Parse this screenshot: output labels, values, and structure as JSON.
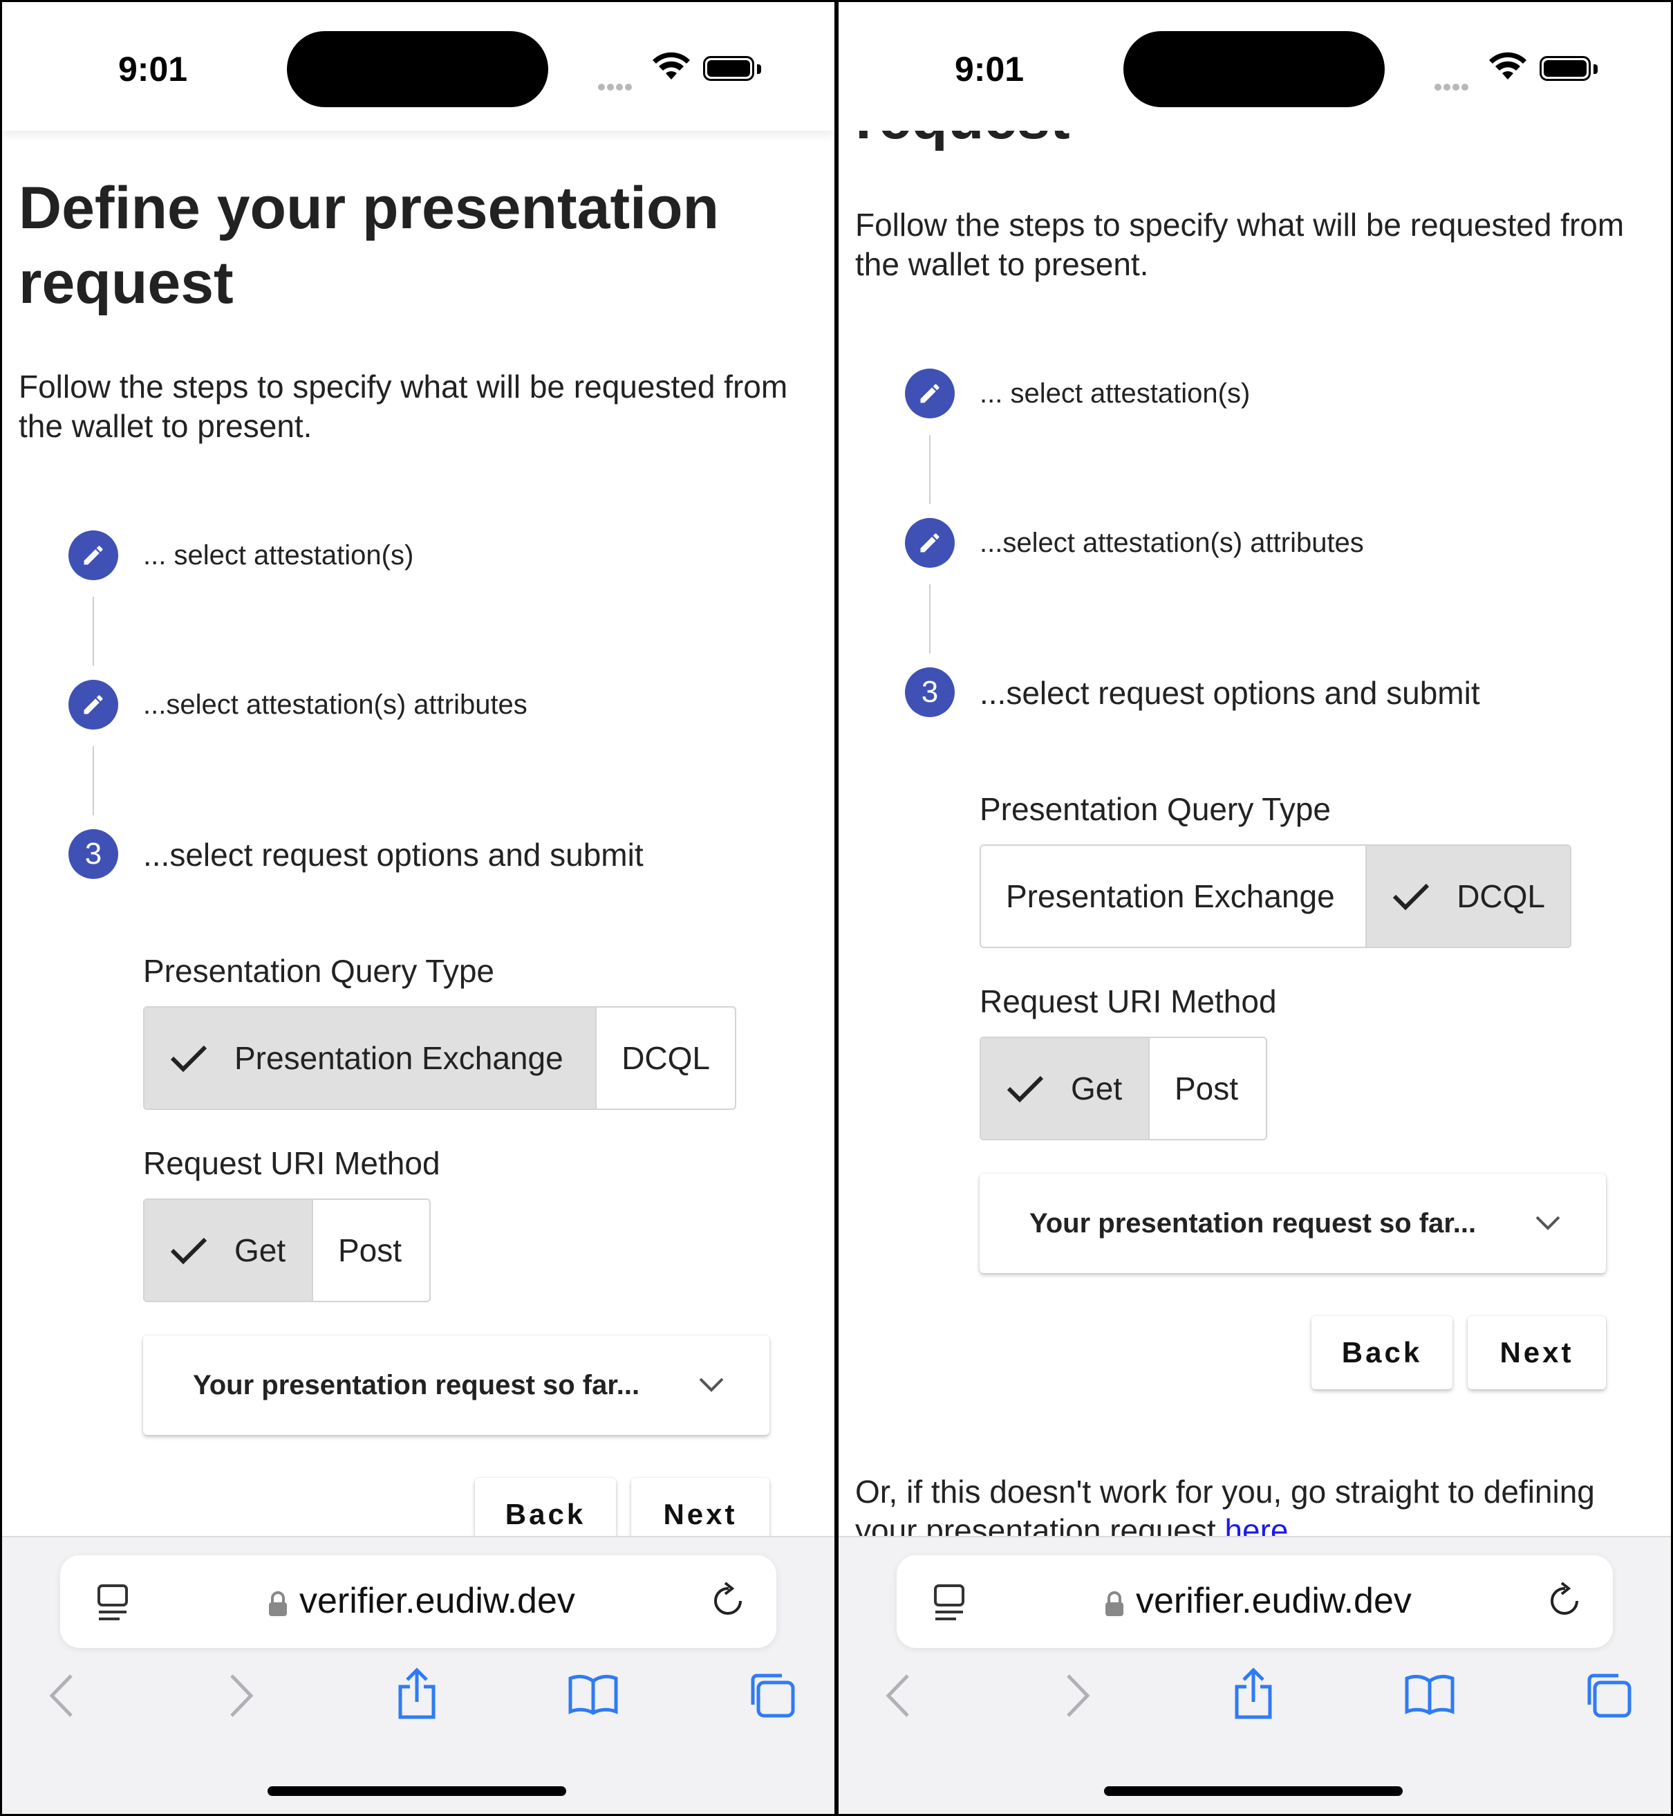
{
  "status_bar": {
    "time": "9:01"
  },
  "page": {
    "title": "Define your presentation request",
    "title_partial": "request",
    "intro": "Follow the steps to specify what will be requested from the wallet to present.",
    "steps": [
      {
        "label": "... select attestation(s)",
        "state": "edit",
        "icon": "pencil-icon"
      },
      {
        "label": "...select attestation(s) attributes",
        "state": "edit",
        "icon": "pencil-icon"
      },
      {
        "label": "...select request options and submit",
        "state": "active",
        "number": "3"
      }
    ],
    "query_type": {
      "label": "Presentation Query Type",
      "options": [
        "Presentation Exchange",
        "DCQL"
      ]
    },
    "uri_method": {
      "label": "Request URI Method",
      "options": [
        "Get",
        "Post"
      ],
      "selected": "Get"
    },
    "summary_panel": {
      "title": "Your presentation request so far...",
      "icon": "chevron-down-icon"
    },
    "back_label": "Back",
    "next_label": "Next",
    "footer_text": "Or, if this doesn't work for you, go straight to defining your presentation request ",
    "footer_link": "here"
  },
  "left_screen": {
    "query_type_selected": "Presentation Exchange"
  },
  "right_screen": {
    "query_type_selected": "DCQL"
  },
  "browser": {
    "url": "verifier.eudiw.dev"
  },
  "colors": {
    "accent": "#3f51b5",
    "selected_toggle": "#e0e0e0",
    "link": "#1a1aee"
  }
}
